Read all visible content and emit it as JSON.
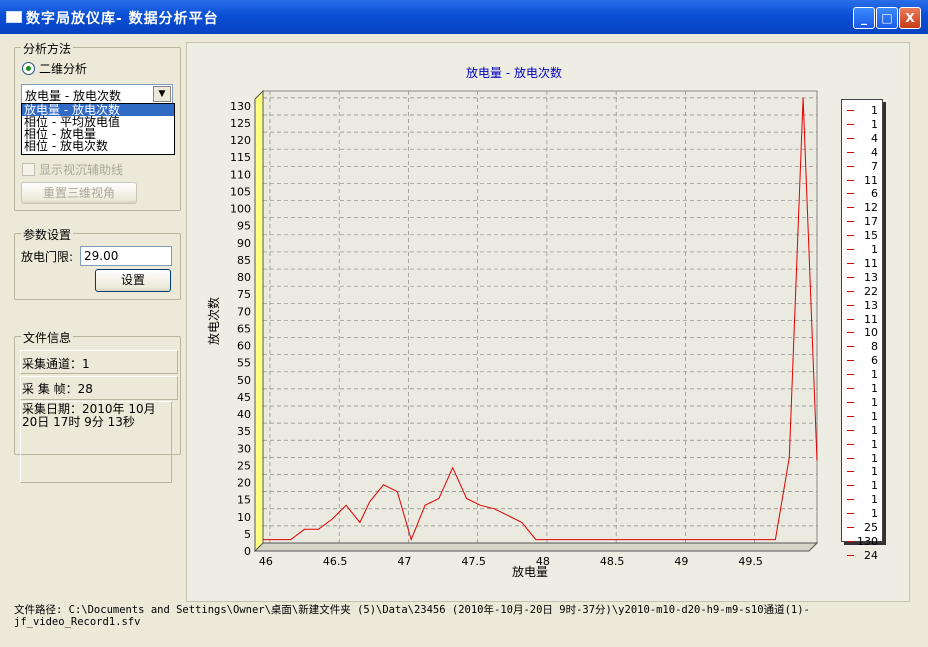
{
  "window": {
    "title": "数字局放仪库- 数据分析平台",
    "minimize": "_",
    "maximize": "□",
    "close": "X"
  },
  "analysis": {
    "legend": "分析方法",
    "radio_label": "二维分析",
    "select_value": "放电量 - 放电次数",
    "options": [
      "放电量 - 放电次数",
      "相位 - 平均放电值",
      "相位 - 放电量",
      "相位 - 放电次数"
    ],
    "checkbox_label": "显示视沉辅助线",
    "reset_button": "重置三维视角"
  },
  "params": {
    "legend": "参数设置",
    "threshold_label": "放电门限:",
    "threshold_value": "29.00",
    "set_button": "设置"
  },
  "fileinfo": {
    "legend": "文件信息",
    "channel": "采集通道：1",
    "frames": "采 集 帧：28",
    "date": "采集日期：2010年 10月 20日 17时 9分 13秒"
  },
  "footer": {
    "path": "文件路径:  C:\\Documents and Settings\\Owner\\桌面\\新建文件夹 (5)\\Data\\23456 (2010年-10月-20日 9时-37分)\\y2010-m10-d20-h9-m9-s10通道(1)-jf_video_Record1.sfv"
  },
  "colors": {
    "series": "#e00000",
    "title": "#0000c0",
    "axis_strip": "#ffff80"
  },
  "chart_data": {
    "type": "line",
    "title": "放电量 - 放电次数",
    "xlabel": "放电量",
    "ylabel": "放电次数",
    "xlim": [
      45.95,
      49.95
    ],
    "ylim": [
      0,
      132
    ],
    "grid": true,
    "legend_placement": "right",
    "xticks": [
      46,
      46.5,
      47,
      47.5,
      48,
      48.5,
      49,
      49.5
    ],
    "yticks": [
      0,
      5,
      10,
      15,
      20,
      25,
      30,
      35,
      40,
      45,
      50,
      55,
      60,
      65,
      70,
      75,
      80,
      85,
      90,
      95,
      100,
      105,
      110,
      115,
      120,
      125,
      130
    ],
    "series": [
      {
        "x": [
          45.95,
          46.15,
          46.25,
          46.35,
          46.45,
          46.55,
          46.65,
          46.72,
          46.82,
          46.92,
          47.02,
          47.12,
          47.22,
          47.32,
          47.42,
          47.52,
          47.62,
          47.72,
          47.82,
          47.92,
          48.1,
          48.4,
          48.7,
          49,
          49.3,
          49.5,
          49.65,
          49.75,
          49.85,
          49.95
        ],
        "y": [
          1,
          1,
          4,
          4,
          7,
          11,
          6,
          12,
          17,
          15,
          1,
          11,
          13,
          22,
          13,
          11,
          10,
          8,
          6,
          1,
          1,
          1,
          1,
          1,
          1,
          1,
          1,
          25,
          130,
          24
        ]
      }
    ],
    "legend_values": [
      "1",
      "1",
      "4",
      "4",
      "7",
      "11",
      "6",
      "12",
      "17",
      "15",
      "1",
      "11",
      "13",
      "22",
      "13",
      "11",
      "10",
      "8",
      "6",
      "1",
      "1",
      "1",
      "1",
      "1",
      "1",
      "1",
      "1",
      "1",
      "1",
      "1",
      "25",
      "130",
      "24"
    ]
  }
}
